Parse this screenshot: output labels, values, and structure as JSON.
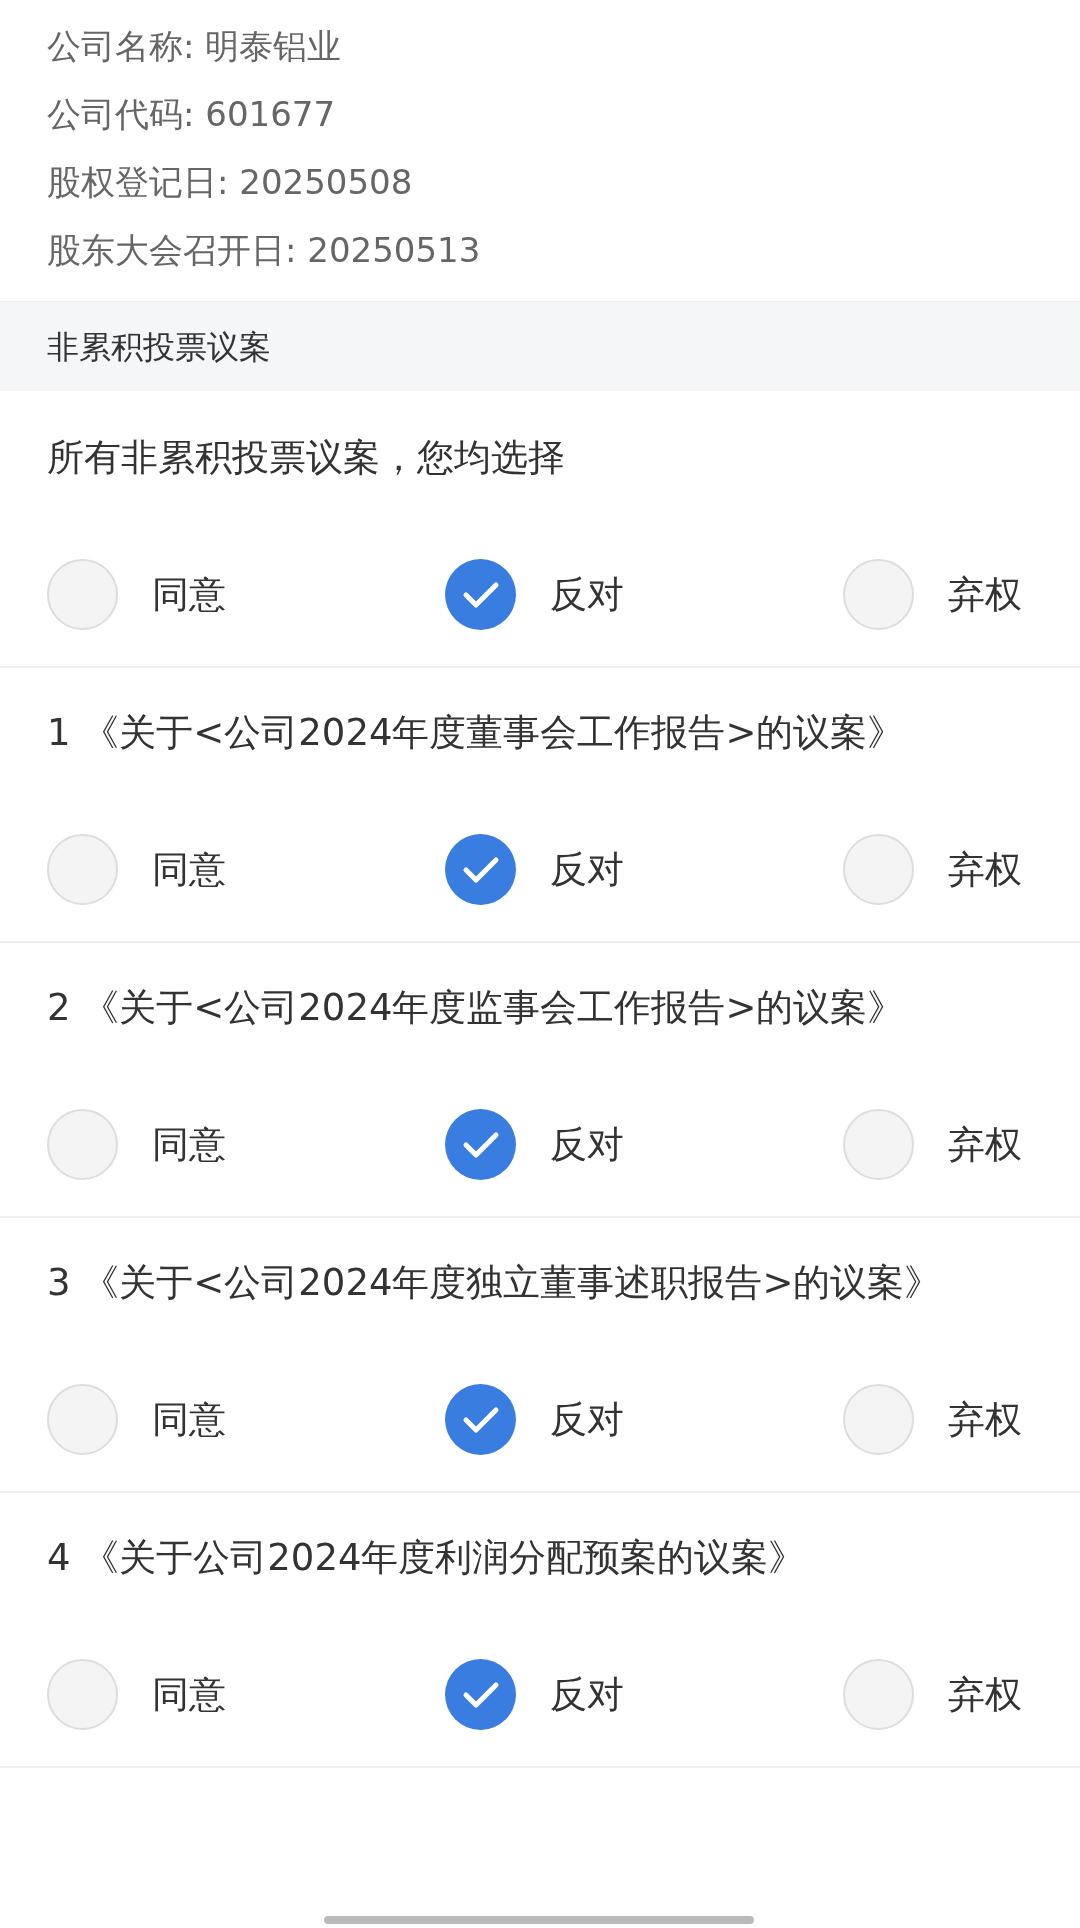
{
  "company_info": [
    "公司名称: 明泰铝业",
    "公司代码: 601677",
    "股权登记日: 20250508",
    "股东大会召开日: 20250513"
  ],
  "section_title": "非累积投票议案",
  "select_all": {
    "prompt": "所有非累积投票议案，您均选择",
    "options": [
      {
        "label": "同意",
        "selected": false
      },
      {
        "label": "反对",
        "selected": true
      },
      {
        "label": "弃权",
        "selected": false
      }
    ]
  },
  "proposals": [
    {
      "title": "1 《关于<公司2024年度董事会工作报告>的议案》",
      "options": [
        {
          "label": "同意",
          "selected": false
        },
        {
          "label": "反对",
          "selected": true
        },
        {
          "label": "弃权",
          "selected": false
        }
      ]
    },
    {
      "title": "2 《关于<公司2024年度监事会工作报告>的议案》",
      "options": [
        {
          "label": "同意",
          "selected": false
        },
        {
          "label": "反对",
          "selected": true
        },
        {
          "label": "弃权",
          "selected": false
        }
      ]
    },
    {
      "title": "3 《关于<公司2024年度独立董事述职报告>的议案》",
      "options": [
        {
          "label": "同意",
          "selected": false
        },
        {
          "label": "反对",
          "selected": true
        },
        {
          "label": "弃权",
          "selected": false
        }
      ]
    },
    {
      "title": "4 《关于公司2024年度利润分配预案的议案》",
      "options": [
        {
          "label": "同意",
          "selected": false
        },
        {
          "label": "反对",
          "selected": true
        },
        {
          "label": "弃权",
          "selected": false
        }
      ]
    }
  ]
}
